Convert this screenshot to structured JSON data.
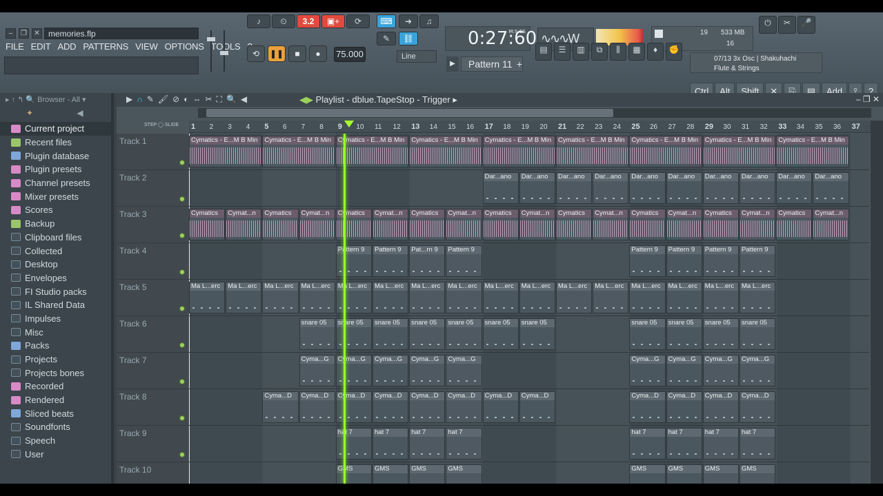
{
  "window": {
    "title": "memories.flp"
  },
  "menu": [
    "FILE",
    "EDIT",
    "ADD",
    "PATTERNS",
    "VIEW",
    "OPTIONS",
    "TOOLS",
    "?"
  ],
  "toolbar": {
    "tempo": "75.000",
    "time": "0:27:60",
    "time_unit": "M:S:CS",
    "pattern": "Pattern 11",
    "snap": "Line",
    "cpu": {
      "value1": "19",
      "memory": "533 MB",
      "value2": "16"
    },
    "hint": {
      "line1": "07/13  3x Osc | Shakuhachi",
      "line2": "Flute & Strings"
    },
    "keys": [
      "Ctrl",
      "Alt",
      "Shift",
      "Add"
    ]
  },
  "browser": {
    "header": "Browser - All",
    "items": [
      {
        "label": "Current project",
        "icon": "project-icon",
        "active": true
      },
      {
        "label": "Recent files",
        "icon": "recent-icon"
      },
      {
        "label": "Plugin database",
        "icon": "plugin-database-icon"
      },
      {
        "label": "Plugin presets",
        "icon": "plugin-presets-icon"
      },
      {
        "label": "Channel presets",
        "icon": "channel-presets-icon"
      },
      {
        "label": "Mixer presets",
        "icon": "mixer-presets-icon"
      },
      {
        "label": "Scores",
        "icon": "scores-icon"
      },
      {
        "label": "Backup",
        "icon": "backup-icon"
      },
      {
        "label": "Clipboard files",
        "icon": "folder-icon"
      },
      {
        "label": "Collected",
        "icon": "folder-icon"
      },
      {
        "label": "Desktop",
        "icon": "folder-icon"
      },
      {
        "label": "Envelopes",
        "icon": "folder-icon"
      },
      {
        "label": "FI Studio packs",
        "icon": "folder-icon"
      },
      {
        "label": "IL Shared Data",
        "icon": "folder-icon"
      },
      {
        "label": "Impulses",
        "icon": "folder-icon"
      },
      {
        "label": "Misc",
        "icon": "folder-icon"
      },
      {
        "label": "Packs",
        "icon": "packs-icon"
      },
      {
        "label": "Projects",
        "icon": "folder-icon"
      },
      {
        "label": "Projects bones",
        "icon": "folder-icon"
      },
      {
        "label": "Recorded",
        "icon": "recorded-icon"
      },
      {
        "label": "Rendered",
        "icon": "rendered-icon"
      },
      {
        "label": "Sliced beats",
        "icon": "sliced-beats-icon"
      },
      {
        "label": "Soundfonts",
        "icon": "folder-icon"
      },
      {
        "label": "Speech",
        "icon": "folder-icon"
      },
      {
        "label": "User",
        "icon": "folder-icon"
      }
    ]
  },
  "playlist": {
    "title": "Playlist - dblue.TapeStop - Trigger",
    "ruler": [
      1,
      2,
      3,
      4,
      5,
      6,
      7,
      8,
      9,
      10,
      11,
      12,
      13,
      14,
      15,
      16,
      17,
      18,
      19,
      20,
      21,
      22,
      23,
      24,
      25,
      26,
      27,
      28,
      29,
      30,
      31,
      32,
      33,
      34,
      35,
      36,
      37
    ],
    "ruler_labels": {
      "step": "STEP",
      "slide": "SLIDE"
    },
    "tracks": [
      "Track 1",
      "Track 2",
      "Track 3",
      "Track 4",
      "Track 5",
      "Track 6",
      "Track 7",
      "Track 8",
      "Track 9",
      "Track 10"
    ],
    "clip_labels": {
      "t1": "Cymatics - E...M B Min",
      "t2": "Dar...ano",
      "t3a": "Cymatics",
      "t3b": "Cymat...n",
      "t4": "Pattern 9",
      "t4b": "Pat...rn 9",
      "t5": "Ma L...erc",
      "t6": "snare 05",
      "t7": "Cyma...G",
      "t8": "Cyma...D",
      "t9": "hat 7",
      "t10": "GMS"
    }
  },
  "colors": {
    "playhead": "#9bff2a",
    "audio_clip": "#d9a8cd",
    "active_dot": "#9bd25b"
  }
}
